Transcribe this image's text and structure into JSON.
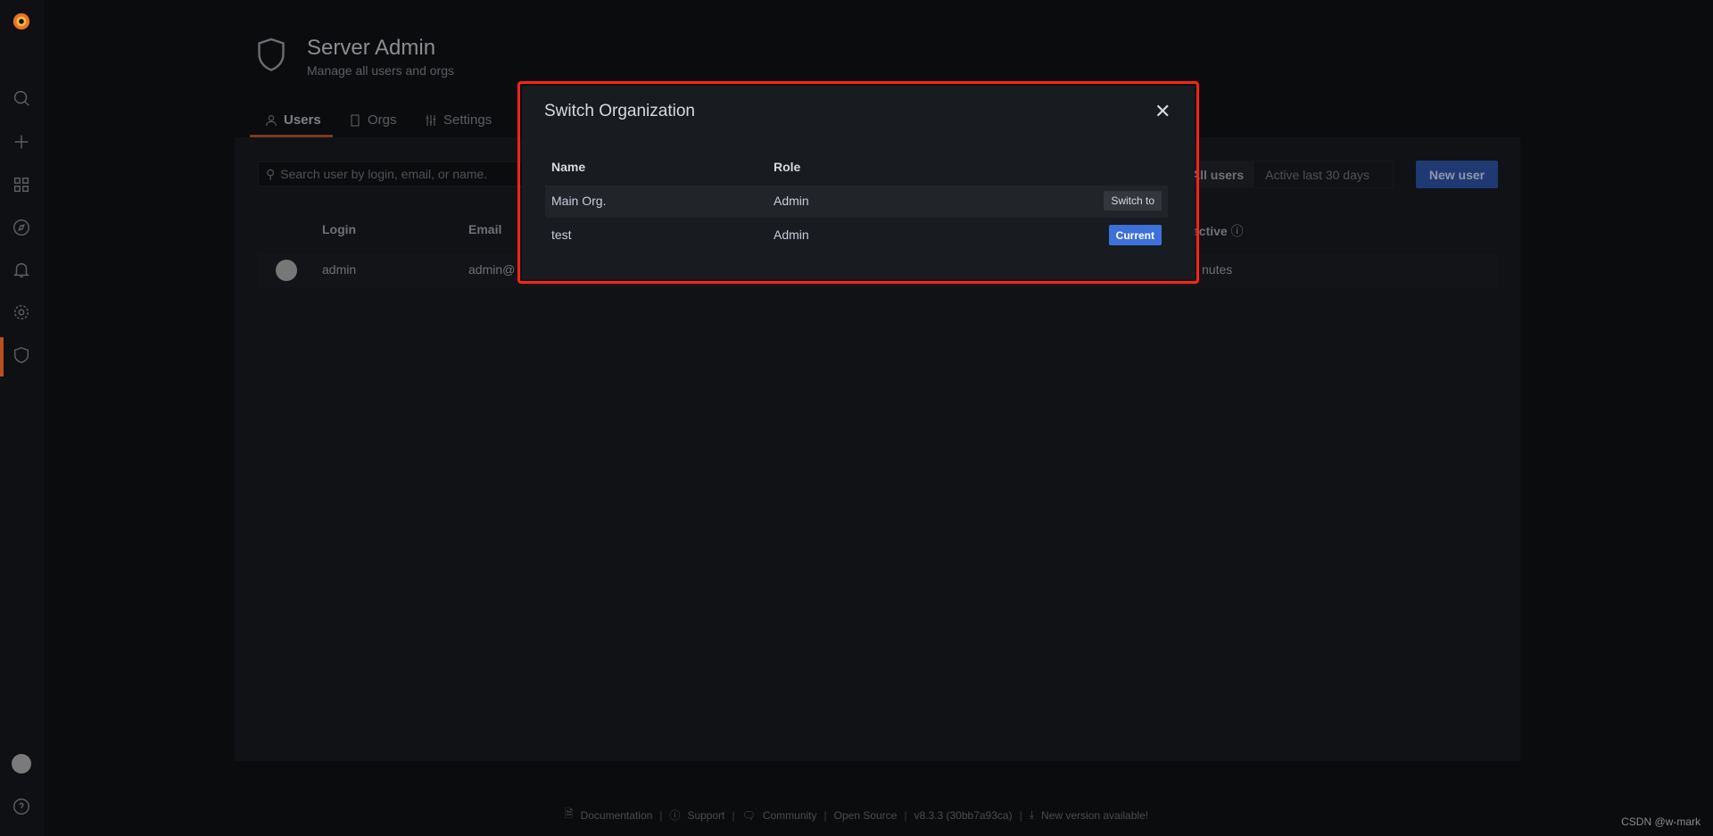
{
  "sidebar": {
    "items": [
      {
        "icon": "search-icon"
      },
      {
        "icon": "plus-icon"
      },
      {
        "icon": "dashboards-icon"
      },
      {
        "icon": "compass-icon"
      },
      {
        "icon": "bell-icon"
      },
      {
        "icon": "gear-icon"
      },
      {
        "icon": "shield-icon",
        "active": true
      }
    ],
    "accent": "#b9501f"
  },
  "header": {
    "title": "Server Admin",
    "subtitle": "Manage all users and orgs"
  },
  "tabs": [
    {
      "label": "Users",
      "active": true
    },
    {
      "label": "Orgs"
    },
    {
      "label": "Settings"
    }
  ],
  "users_page": {
    "search_placeholder": "Search user by login, email, or name.",
    "filters": [
      "All users",
      "Active last 30 days"
    ],
    "new_user": "New user",
    "columns": {
      "login": "Login",
      "email": "Email",
      "last_active": "active"
    },
    "rows": [
      {
        "login": "admin",
        "email": "admin@",
        "last_active": "nutes"
      }
    ]
  },
  "modal": {
    "title": "Switch Organization",
    "columns": {
      "name": "Name",
      "role": "Role"
    },
    "rows": [
      {
        "name": "Main Org.",
        "role": "Admin",
        "action": "Switch to"
      },
      {
        "name": "test",
        "role": "Admin",
        "action": "Current"
      }
    ],
    "highlight_color": "#ff2318",
    "current_color": "#3d71d9"
  },
  "footer": {
    "items": [
      "Documentation",
      "Support",
      "Community",
      "Open Source",
      "v8.3.3 (30bb7a93ca)",
      "New version available!"
    ]
  },
  "watermark": "CSDN @w-mark"
}
